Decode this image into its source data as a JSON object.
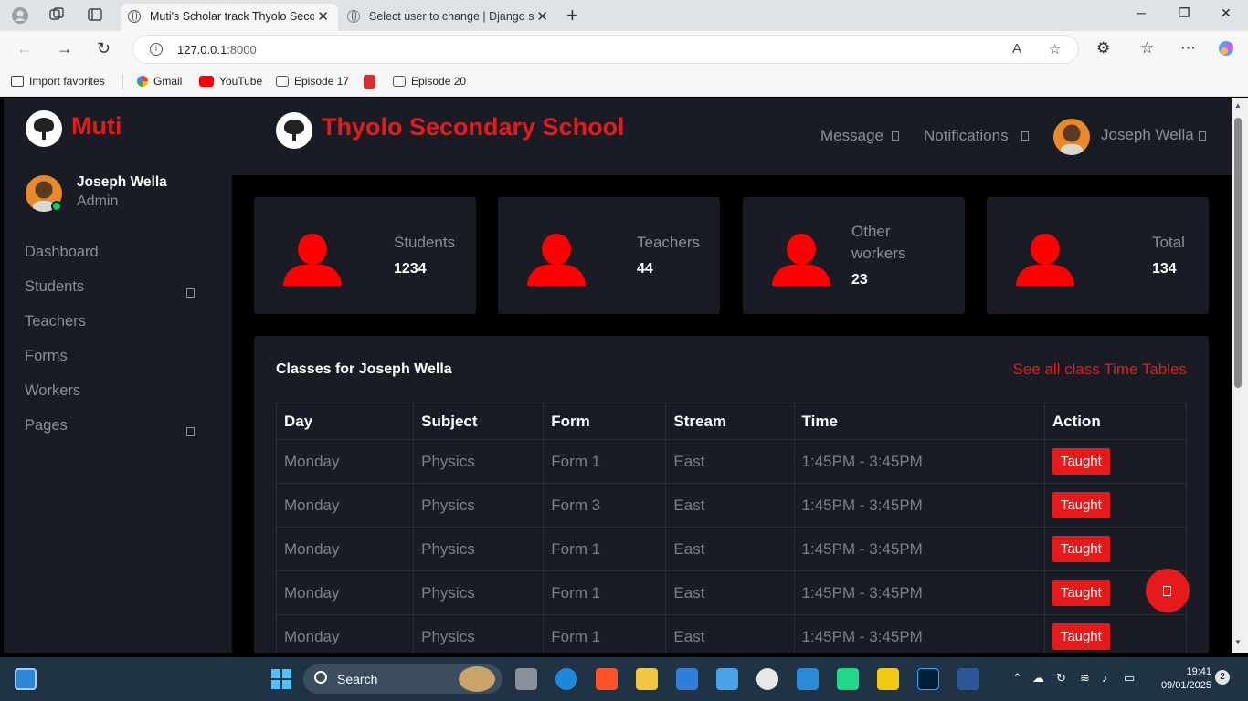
{
  "browser": {
    "tabs": [
      {
        "title": "Muti's Scholar track Thyolo Secon",
        "active": true
      },
      {
        "title": "Select user to change | Django site",
        "active": false
      }
    ],
    "url_host": "127.0.0.1",
    "url_port": ":8000",
    "favorites": [
      {
        "label": "Import favorites",
        "icon": "import-icon"
      },
      {
        "label": "Gmail",
        "icon": "google-icon"
      },
      {
        "label": "YouTube",
        "icon": "youtube-icon"
      },
      {
        "label": "Episode 17",
        "icon": "page-icon"
      },
      {
        "label": "",
        "icon": "pdf-icon"
      },
      {
        "label": "Episode 20",
        "icon": "page-icon"
      }
    ]
  },
  "sidebar": {
    "brand": "Muti",
    "user_name": "Joseph Wella",
    "user_role": "Admin",
    "items": [
      {
        "label": "Dashboard",
        "has_submenu": false
      },
      {
        "label": "Students",
        "has_submenu": true
      },
      {
        "label": "Teachers",
        "has_submenu": false
      },
      {
        "label": "Forms",
        "has_submenu": false
      },
      {
        "label": "Workers",
        "has_submenu": false
      },
      {
        "label": "Pages",
        "has_submenu": true
      }
    ]
  },
  "topbar": {
    "school_name": "Thyolo Secondary School",
    "message_label": "Message",
    "notifications_label": "Notifications",
    "user_name": "Joseph Wella"
  },
  "cards": [
    {
      "label": "Students",
      "value": "1234"
    },
    {
      "label": "Teachers",
      "value": "44"
    },
    {
      "label": "Other workers",
      "value": "23"
    },
    {
      "label": "Total",
      "value": "134"
    }
  ],
  "classes": {
    "title": "Classes for Joseph Wella",
    "link": "See all class Time Tables",
    "columns": [
      "Day",
      "Subject",
      "Form",
      "Stream",
      "Time",
      "Action"
    ],
    "rows": [
      [
        "Monday",
        "Physics",
        "Form 1",
        "East",
        "1:45PM - 3:45PM",
        "Taught"
      ],
      [
        "Monday",
        "Physics",
        "Form 3",
        "East",
        "1:45PM - 3:45PM",
        "Taught"
      ],
      [
        "Monday",
        "Physics",
        "Form 1",
        "East",
        "1:45PM - 3:45PM",
        "Taught"
      ],
      [
        "Monday",
        "Physics",
        "Form 1",
        "East",
        "1:45PM - 3:45PM",
        "Taught"
      ],
      [
        "Monday",
        "Physics",
        "Form 1",
        "East",
        "1:45PM - 3:45PM",
        "Taught"
      ]
    ]
  },
  "taskbar": {
    "search_placeholder": "Search",
    "time": "19:41",
    "date": "09/01/2025",
    "notification_count": "2"
  },
  "colors": {
    "accent": "#e51a1a",
    "panel": "#191c24",
    "background": "#000000",
    "muted_text": "#8a8d98"
  }
}
